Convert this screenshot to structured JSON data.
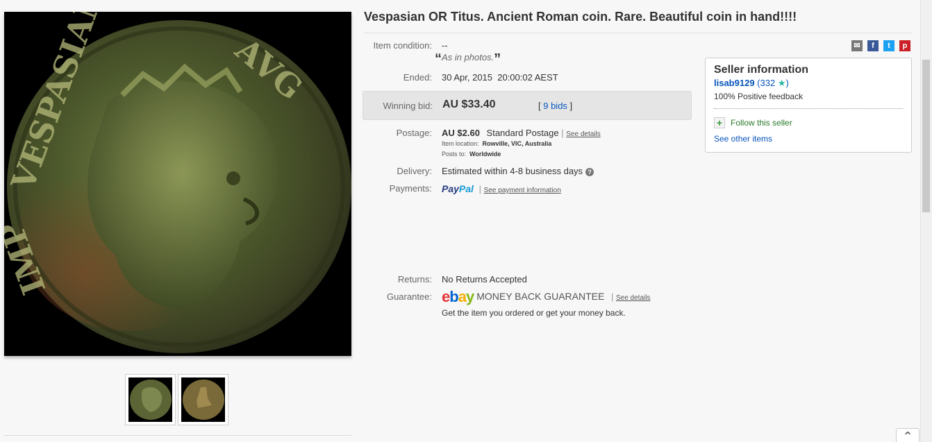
{
  "listing": {
    "title": "Vespasian OR Titus. Ancient Roman coin. Rare. Beautiful coin in hand!!!!"
  },
  "details": {
    "condition_label": "Item condition:",
    "condition_value": "--",
    "condition_note": "As in photos.",
    "ended_label": "Ended:",
    "ended_value": "30 Apr, 2015  20:00:02 AEST",
    "winning_label": "Winning bid:",
    "winning_value": "AU $33.40",
    "bids_link": "9 bids",
    "postage_label": "Postage:",
    "postage_price": "AU $2.60",
    "postage_method": "Standard Postage",
    "postage_see": "See details",
    "item_location_label": "Item location:",
    "item_location_value": "Rowville, VIC, Australia",
    "posts_to_label": "Posts to:",
    "posts_to_value": "Worldwide",
    "delivery_label": "Delivery:",
    "delivery_value": "Estimated within 4-8 business days",
    "payments_label": "Payments:",
    "paypal_pay": "Pay",
    "paypal_pal": "Pal",
    "payment_see": "See payment information",
    "returns_label": "Returns:",
    "returns_value": "No Returns Accepted",
    "guarantee_label": "Guarantee:",
    "ebay_e": "e",
    "ebay_b": "b",
    "ebay_a": "a",
    "ebay_y": "y",
    "guarantee_text": "MONEY BACK GUARANTEE",
    "guarantee_see": "See details",
    "guarantee_sub": "Get the item you ordered or get your money back."
  },
  "seller": {
    "title": "Seller information",
    "username": "lisab9129",
    "score_open": "(332",
    "score_close": ")",
    "star": "★",
    "feedback": "100% Positive feedback",
    "follow_plus": "+",
    "follow": "Follow this seller",
    "other_items": "See other items"
  },
  "share": {
    "email": "✉",
    "facebook": "f",
    "twitter": "t",
    "pinterest": "p"
  },
  "colors": {
    "link": "#0654ba",
    "facebook": "#3b5998",
    "twitter": "#1da1f2",
    "pinterest": "#cb2027",
    "email": "#777777"
  },
  "icons": [
    "email-share-icon",
    "facebook-icon",
    "twitter-icon",
    "pinterest-icon",
    "help-icon",
    "star-icon",
    "plus-icon",
    "chevron-up-icon"
  ],
  "back_to_top": "⌃"
}
